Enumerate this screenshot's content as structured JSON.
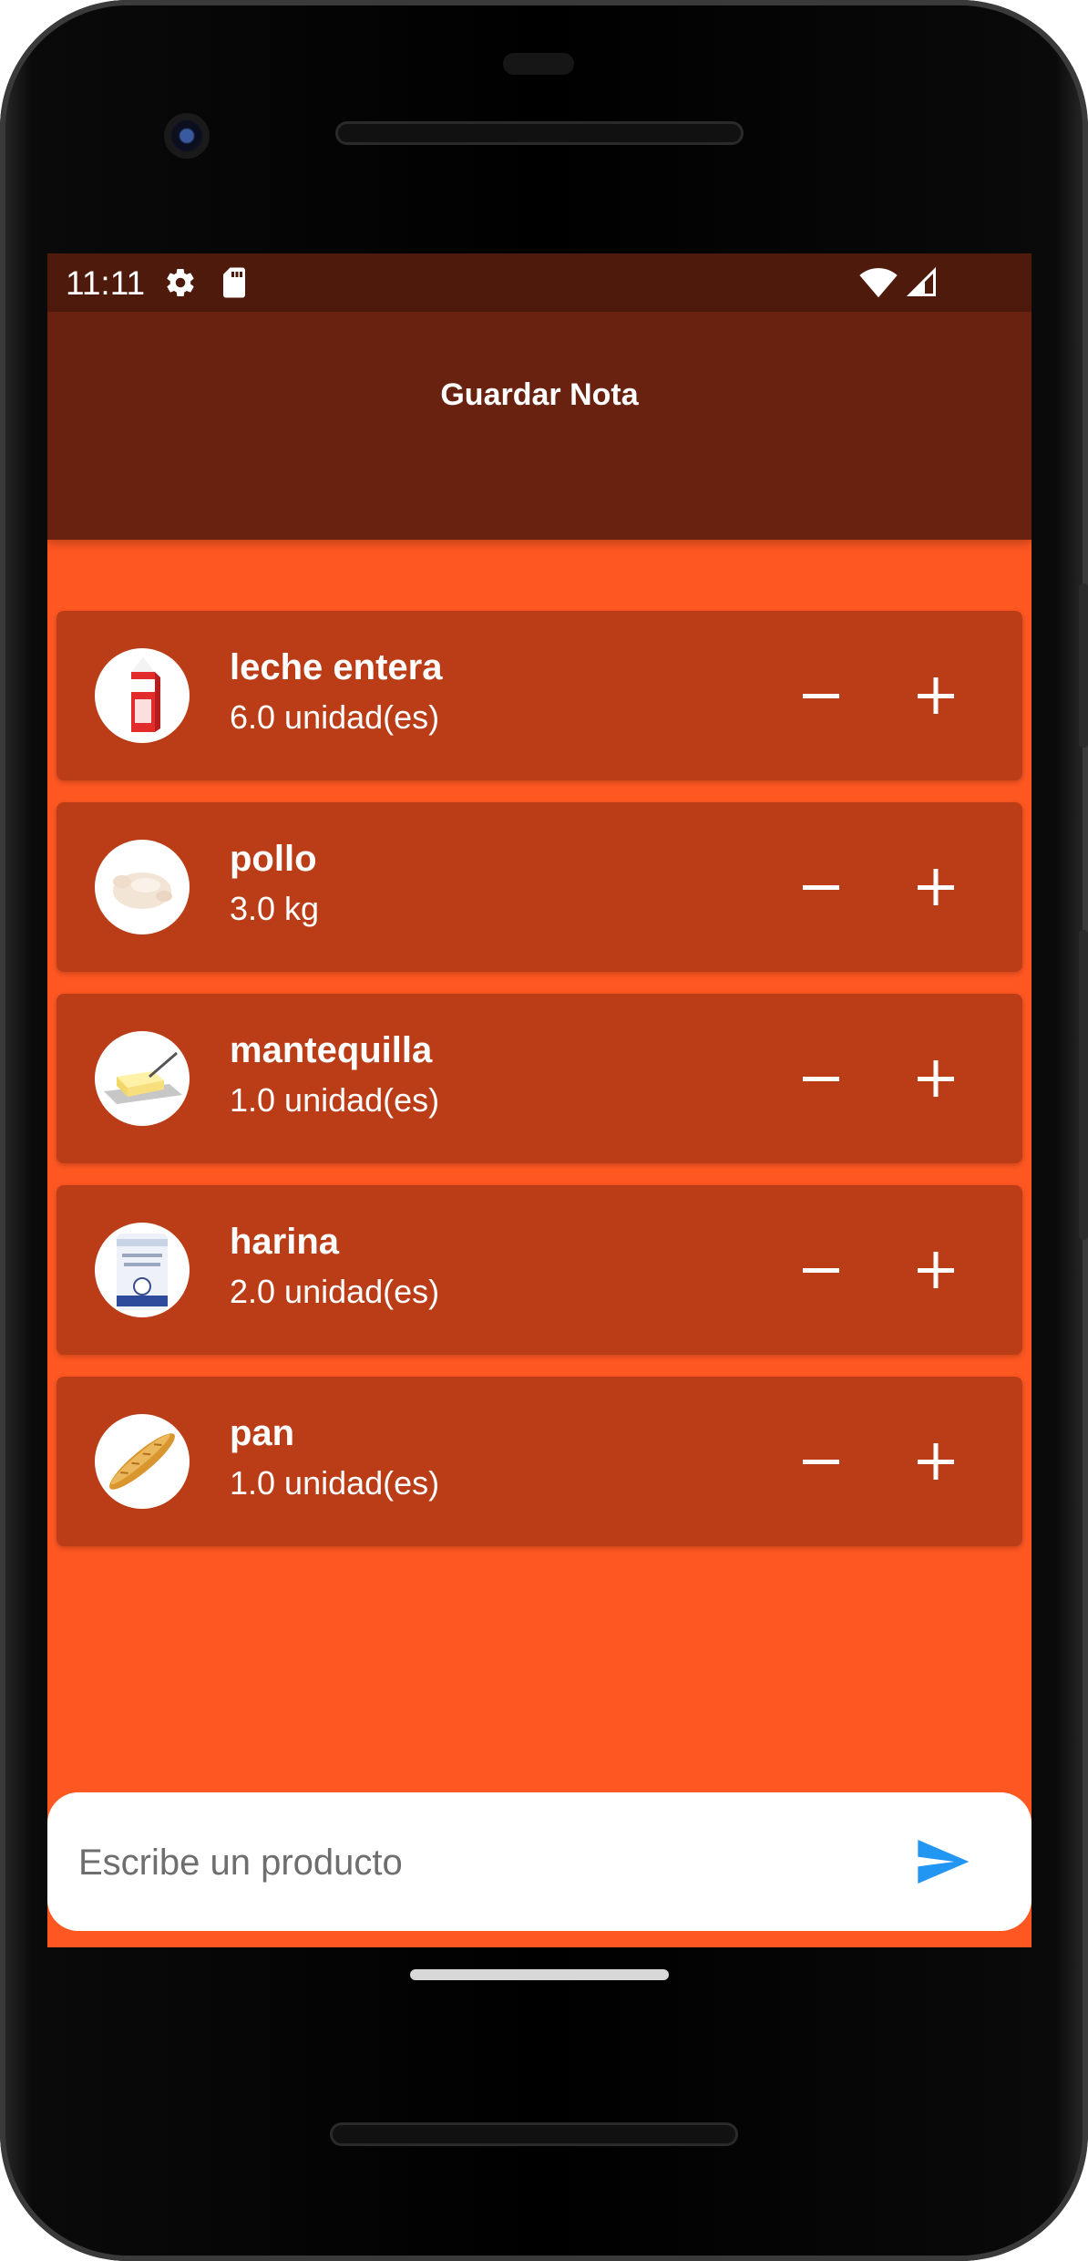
{
  "status_bar": {
    "time": "11:11"
  },
  "app_bar": {
    "title": "Guardar Nota"
  },
  "items": [
    {
      "name": "leche entera",
      "quantity": "6.0 unidad(es)",
      "image": "milk-carton"
    },
    {
      "name": "pollo",
      "quantity": "3.0 kg",
      "image": "raw-chicken"
    },
    {
      "name": "mantequilla",
      "quantity": "1.0 unidad(es)",
      "image": "butter"
    },
    {
      "name": "harina",
      "quantity": "2.0 unidad(es)",
      "image": "flour-bag"
    },
    {
      "name": "pan",
      "quantity": "1.0 unidad(es)",
      "image": "baguette"
    }
  ],
  "composer": {
    "placeholder": "Escribe un producto"
  },
  "colors": {
    "background": "#fe5722",
    "app_bar": "#692210",
    "status_bar": "#4e1a0b",
    "card": "#ba3d17",
    "send_icon": "#2196f3"
  }
}
